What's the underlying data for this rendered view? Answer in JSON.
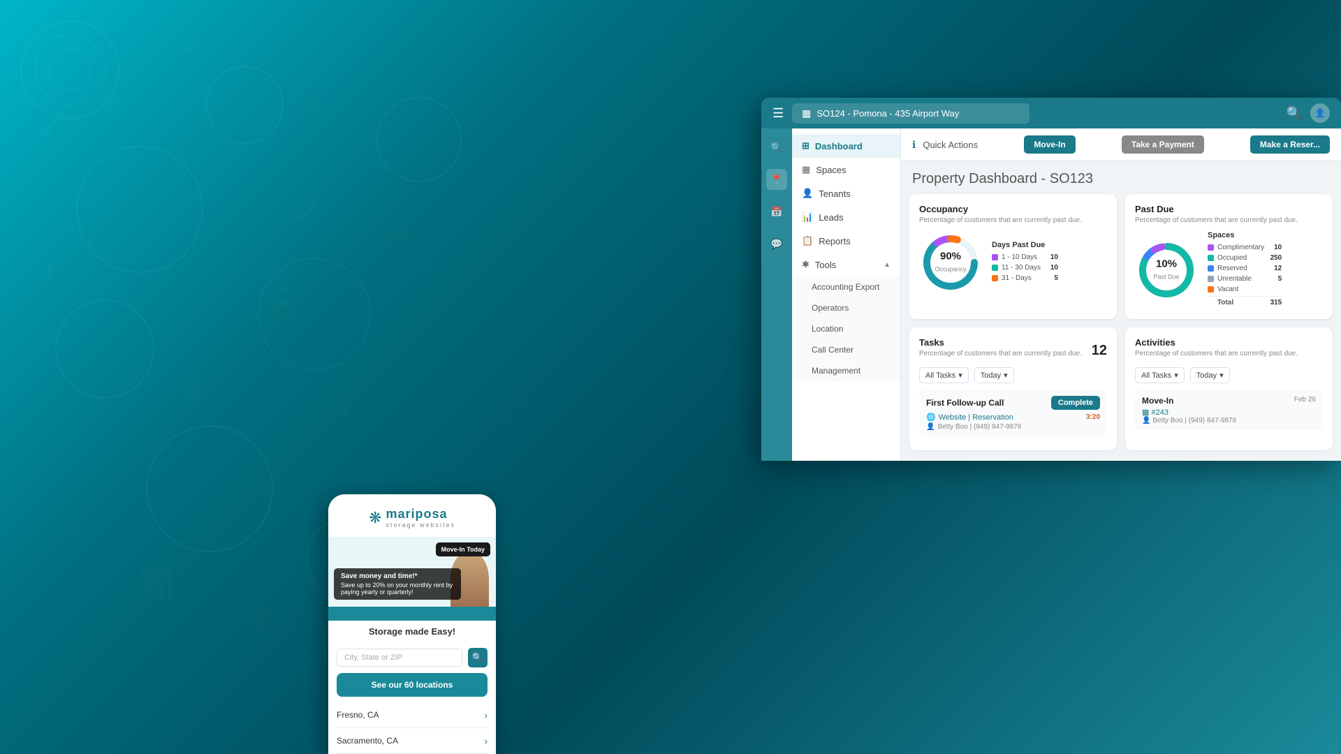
{
  "background": {
    "color_start": "#00b5c8",
    "color_end": "#004a5a"
  },
  "topbar": {
    "menu_icon": "☰",
    "location_icon": "▦",
    "location_text": "SO124 - Pomona - 435 Airport Way",
    "search_icon": "🔍",
    "avatar_icon": "👤"
  },
  "sidebar_icons": [
    {
      "name": "search",
      "icon": "🔍",
      "active": false
    },
    {
      "name": "location",
      "icon": "📍",
      "active": true
    },
    {
      "name": "calendar",
      "icon": "📅",
      "active": false
    },
    {
      "name": "messages",
      "icon": "💬",
      "active": false
    }
  ],
  "nav": {
    "items": [
      {
        "id": "dashboard",
        "label": "Dashboard",
        "icon": "⊞",
        "active": true
      },
      {
        "id": "spaces",
        "label": "Spaces",
        "icon": "▦",
        "active": false
      },
      {
        "id": "tenants",
        "label": "Tenants",
        "icon": "👤",
        "active": false
      },
      {
        "id": "leads",
        "label": "Leads",
        "icon": "📊",
        "active": false
      },
      {
        "id": "reports",
        "label": "Reports",
        "icon": "📋",
        "active": false
      },
      {
        "id": "tools",
        "label": "Tools",
        "icon": "✱",
        "active": false,
        "expanded": true
      }
    ],
    "tools_submenu": [
      {
        "id": "accounting-export",
        "label": "Accounting Export"
      },
      {
        "id": "operators",
        "label": "Operators"
      },
      {
        "id": "location",
        "label": "Location"
      },
      {
        "id": "call-center",
        "label": "Call Center"
      },
      {
        "id": "management",
        "label": "Management"
      }
    ]
  },
  "quick_actions": {
    "info_icon": "ℹ",
    "label": "Quick Actions",
    "btn_movein": "Move-In",
    "btn_payment": "Take a Payment",
    "btn_reserve": "Make a Reser..."
  },
  "dashboard": {
    "title": "Property Dashboard",
    "subtitle": "- SO123"
  },
  "occupancy_card": {
    "title": "Occupancy",
    "subtitle": "Percentage of customers that are currently past due.",
    "percentage": "90%",
    "center_label": "Occupancy",
    "legend_title": "Days Past Due",
    "legend": [
      {
        "label": "1 - 10 Days",
        "color": "#a855f7",
        "value": "10"
      },
      {
        "label": "11 - 30 Days",
        "color": "#14b8a6",
        "value": "10"
      },
      {
        "label": "31 - Days",
        "color": "#f97316",
        "value": "5"
      }
    ],
    "donut_colors": {
      "main": "#1a9aaa",
      "segment1": "#a855f7",
      "segment2": "#14b8a6",
      "segment3": "#f97316",
      "track": "#e8f4f6"
    }
  },
  "past_due_card": {
    "title": "Past Due",
    "subtitle": "Percentage of customers that are currently past due.",
    "percentage": "10%",
    "center_label": "Past Due",
    "legend_title": "Spaces",
    "legend": [
      {
        "label": "Complimentary",
        "color": "#a855f7",
        "value": "10"
      },
      {
        "label": "Occupied",
        "color": "#14b8a6",
        "value": "250"
      },
      {
        "label": "Reserved",
        "color": "#3b82f6",
        "value": "12"
      },
      {
        "label": "Unrentable",
        "color": "#94a3b8",
        "value": "5"
      },
      {
        "label": "Vacant",
        "color": "#f97316",
        "value": ""
      },
      {
        "label": "Total",
        "color": "transparent",
        "value": "315",
        "bold": true
      }
    ]
  },
  "tasks_card": {
    "title": "Tasks",
    "subtitle": "Percentage of customers that are currently past due.",
    "count": "12",
    "filter_all_tasks": "All Tasks",
    "filter_today": "Today",
    "task": {
      "name": "First Follow-up Call",
      "complete_btn": "Complete",
      "link_text": "Website | Reservation",
      "link_icon": "🌐",
      "time": "3:20",
      "person": "Betty Boo | (949) 847-9876",
      "person_icon": "👤"
    }
  },
  "activities_card": {
    "title": "Activities",
    "subtitle": "Percentage of customers that are currently past due.",
    "filter_all_tasks": "All Tasks",
    "filter_today": "Today",
    "activity": {
      "type": "Move-In",
      "date": "Feb 26",
      "unit": "#243",
      "unit_icon": "▦",
      "person": "Betty Boo | (949) 847-9876",
      "person_icon": "👤"
    }
  },
  "phone": {
    "logo_icon": "✿",
    "logo_text": "mariposa",
    "logo_sub": "storage websites",
    "promo_title": "Save money and time!*",
    "promo_body": "Save up to 20% on your monthly rent by paying yearly or quarterly!",
    "cta_btn": "Move-In Today",
    "tagline": "Storage made Easy!",
    "search_placeholder": "City, State or ZIP",
    "search_btn": "🔍",
    "see_locations": "See our 60 locations",
    "locations": [
      {
        "city": "Fresno, CA"
      },
      {
        "city": "Sacramento, CA"
      }
    ]
  }
}
